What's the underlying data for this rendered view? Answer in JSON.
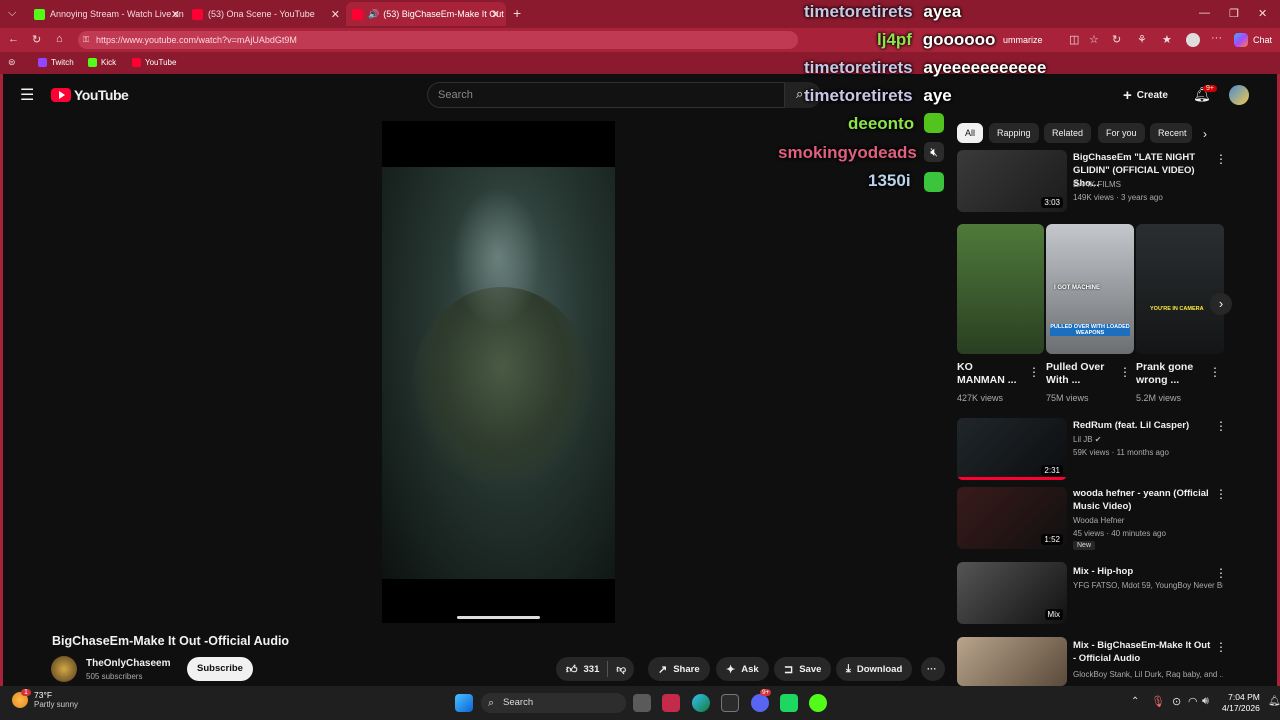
{
  "browser": {
    "tabs": [
      {
        "label": "Annoying Stream - Watch Live on",
        "favicon_color": "#53fc18"
      },
      {
        "label": "(53) Ona Scene - YouTube",
        "favicon_color": "#ff0033"
      },
      {
        "label": "(53) BigChaseEm-Make It Out",
        "favicon_color": "#ff0033"
      }
    ],
    "url": "https://www.youtube.com/watch?v=mAjUAbdGt9M",
    "summarize_label": "ummarize",
    "chat_label": "Chat",
    "bookmarks": [
      {
        "label": "Twitch",
        "color": "#9146ff"
      },
      {
        "label": "Kick",
        "color": "#53fc18"
      },
      {
        "label": "YouTube",
        "color": "#ff0033"
      }
    ]
  },
  "youtube": {
    "logo": "YouTube",
    "search_placeholder": "Search",
    "create_label": "Create",
    "notif_count": "9+",
    "chips": [
      "All",
      "Rapping",
      "Related",
      "For you",
      "Recent"
    ],
    "video": {
      "title": "BigChaseEm-Make It Out -Official Audio",
      "channel": "TheOnlyChaseem",
      "subscribers": "505 subscribers",
      "subscribe_label": "Subscribe",
      "likes": "331",
      "share_label": "Share",
      "ask_label": "Ask",
      "save_label": "Save",
      "download_label": "Download"
    },
    "recommendations": [
      {
        "title": "BigChaseEm \"LATE NIGHT GLIDIN\" (OFFICIAL VIDEO) Sho...",
        "channel": "EA 4K FILMS",
        "meta": "149K views · 3 years ago",
        "duration": "3:03"
      },
      {
        "title": "RedRum (feat. Lil Casper)",
        "channel": "Lil JB",
        "meta": "59K views · 11 months ago",
        "duration": "2:31"
      },
      {
        "title": "wooda hefner - yeann (Official Music Video)",
        "channel": "Wooda Hefner",
        "meta": "45 views · 40 minutes ago",
        "duration": "1:52",
        "badge": "New"
      },
      {
        "title": "Mix - Hip-hop",
        "channel": "YFG FATSO, Mdot 59, YoungBoy Never Br...",
        "meta": "",
        "duration": "Mix"
      },
      {
        "title": "Mix - BigChaseEm-Make It Out - Official Audio",
        "channel": "GlockBoy Stank, Lil Durk, Raq baby, and ...",
        "meta": "",
        "duration": ""
      }
    ],
    "shorts": [
      {
        "title": "KO MANMAN ...",
        "views": "427K views"
      },
      {
        "title": "Pulled Over With ...",
        "views": "75M views",
        "overlay1": "I GOT MACHINE",
        "overlay2": "PULLED OVER WITH LOADED WEAPONS"
      },
      {
        "title": "Prank gone wrong ...",
        "views": "5.2M views",
        "overlay1": "YOU'RE IN CAMERA"
      }
    ]
  },
  "chat": [
    {
      "user": "timetoretirets",
      "message": "ayea",
      "color": "#c8c8e6"
    },
    {
      "user": "lj4pf",
      "message": "goooooo",
      "color": "#8ee44a"
    },
    {
      "user": "timetoretirets",
      "message": "ayeeeeeeeeeee",
      "color": "#c8c8e6"
    },
    {
      "user": "timetoretirets",
      "message": "aye",
      "color": "#c8c8e6"
    },
    {
      "user": "deeonto",
      "message": "",
      "color": "#8ee44a"
    },
    {
      "user": "smokingyodeads",
      "message": "",
      "color": "#e0607e"
    },
    {
      "user": "1350i",
      "message": "",
      "color": "#b8d4ee"
    }
  ],
  "taskbar": {
    "weather_temp": "73°F",
    "weather_desc": "Partly sunny",
    "weather_badge": "1",
    "search_label": "Search",
    "discord_badge": "9+",
    "time": "7:04 PM",
    "date": "4/17/2026"
  }
}
